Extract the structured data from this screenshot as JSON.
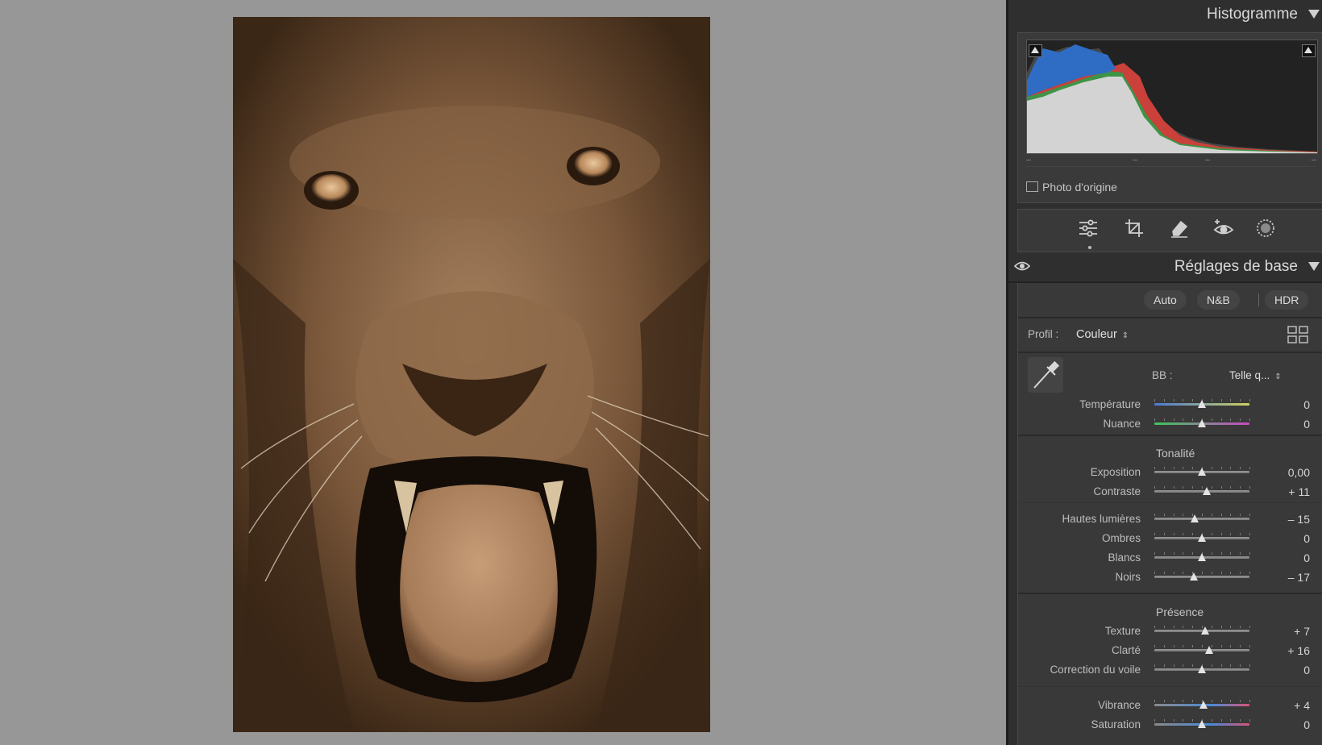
{
  "photo": {
    "subject": ""
  },
  "panel": {
    "histogram_title": "Histogramme",
    "original_photo_label": "Photo d'origine",
    "tools": [
      "edit-sliders-icon",
      "crop-icon",
      "heal-eraser-icon",
      "red-eye-icon",
      "mask-icon"
    ],
    "basic_title": "Réglages de base",
    "buttons": {
      "auto": "Auto",
      "bw": "N&B",
      "hdr": "HDR"
    },
    "profile": {
      "label": "Profil :",
      "value": "Couleur"
    },
    "wb": {
      "label": "BB :",
      "value": "Telle q..."
    },
    "sliders": {
      "temperature": {
        "label": "Température",
        "value": "0",
        "pos": 0.5
      },
      "nuance": {
        "label": "Nuance",
        "value": "0",
        "pos": 0.5
      },
      "exposure": {
        "label": "Exposition",
        "value": "0,00",
        "pos": 0.5
      },
      "contrast": {
        "label": "Contraste",
        "value": "+ 11",
        "pos": 0.555
      },
      "highlights": {
        "label": "Hautes lumières",
        "value": "– 15",
        "pos": 0.425
      },
      "shadows": {
        "label": "Ombres",
        "value": "0",
        "pos": 0.5
      },
      "whites": {
        "label": "Blancs",
        "value": "0",
        "pos": 0.5
      },
      "blacks": {
        "label": "Noirs",
        "value": "– 17",
        "pos": 0.415
      },
      "texture": {
        "label": "Texture",
        "value": "+ 7",
        "pos": 0.535
      },
      "clarity": {
        "label": "Clarté",
        "value": "+ 16",
        "pos": 0.58
      },
      "dehaze": {
        "label": "Correction du voile",
        "value": "0",
        "pos": 0.5
      },
      "vibrance": {
        "label": "Vibrance",
        "value": "+ 4",
        "pos": 0.52
      },
      "saturation": {
        "label": "Saturation",
        "value": "0",
        "pos": 0.5
      }
    },
    "groups": {
      "tone": "Tonalité",
      "presence": "Présence"
    }
  }
}
